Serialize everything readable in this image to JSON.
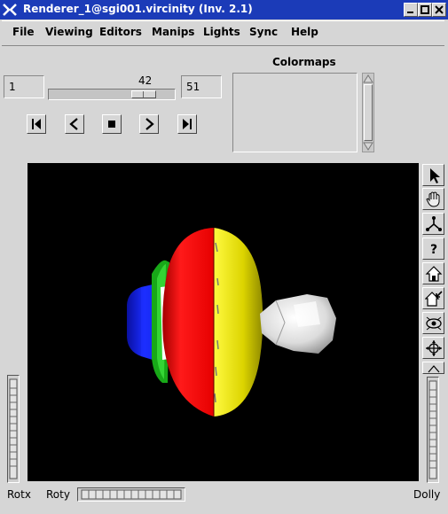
{
  "window": {
    "title": "Renderer_1@sgi001.vircinity (Inv. 2.1)"
  },
  "menu": [
    "File",
    "Viewing",
    "Editors",
    "Manips",
    "Lights",
    "Sync",
    "Help"
  ],
  "animation": {
    "start_value": "1",
    "current_value": "42",
    "end_value": "51",
    "position_fraction": 0.82
  },
  "colormaps": {
    "label": "Colormaps"
  },
  "wheels": {
    "rotx_label": "Rotx",
    "roty_label": "Roty",
    "dolly_label": "Dolly"
  },
  "viewer": {
    "background": "#000000"
  },
  "icons": {
    "titlebar": "window-menu-icon",
    "playback": [
      "first-frame-icon",
      "step-back-icon",
      "stop-icon",
      "step-forward-icon",
      "last-frame-icon"
    ],
    "tools": [
      "pick-arrow-icon",
      "view-hand-icon",
      "seek-icon",
      "help-icon",
      "home-icon",
      "set-home-icon",
      "view-all-icon",
      "seek-target-icon",
      "perspective-icon"
    ]
  },
  "colors": {
    "title_bar": "#1b3bb8",
    "red": "#e80000",
    "yellow": "#e8e600",
    "green": "#1fb81f",
    "blue": "#1020e6",
    "white": "#ffffff"
  }
}
